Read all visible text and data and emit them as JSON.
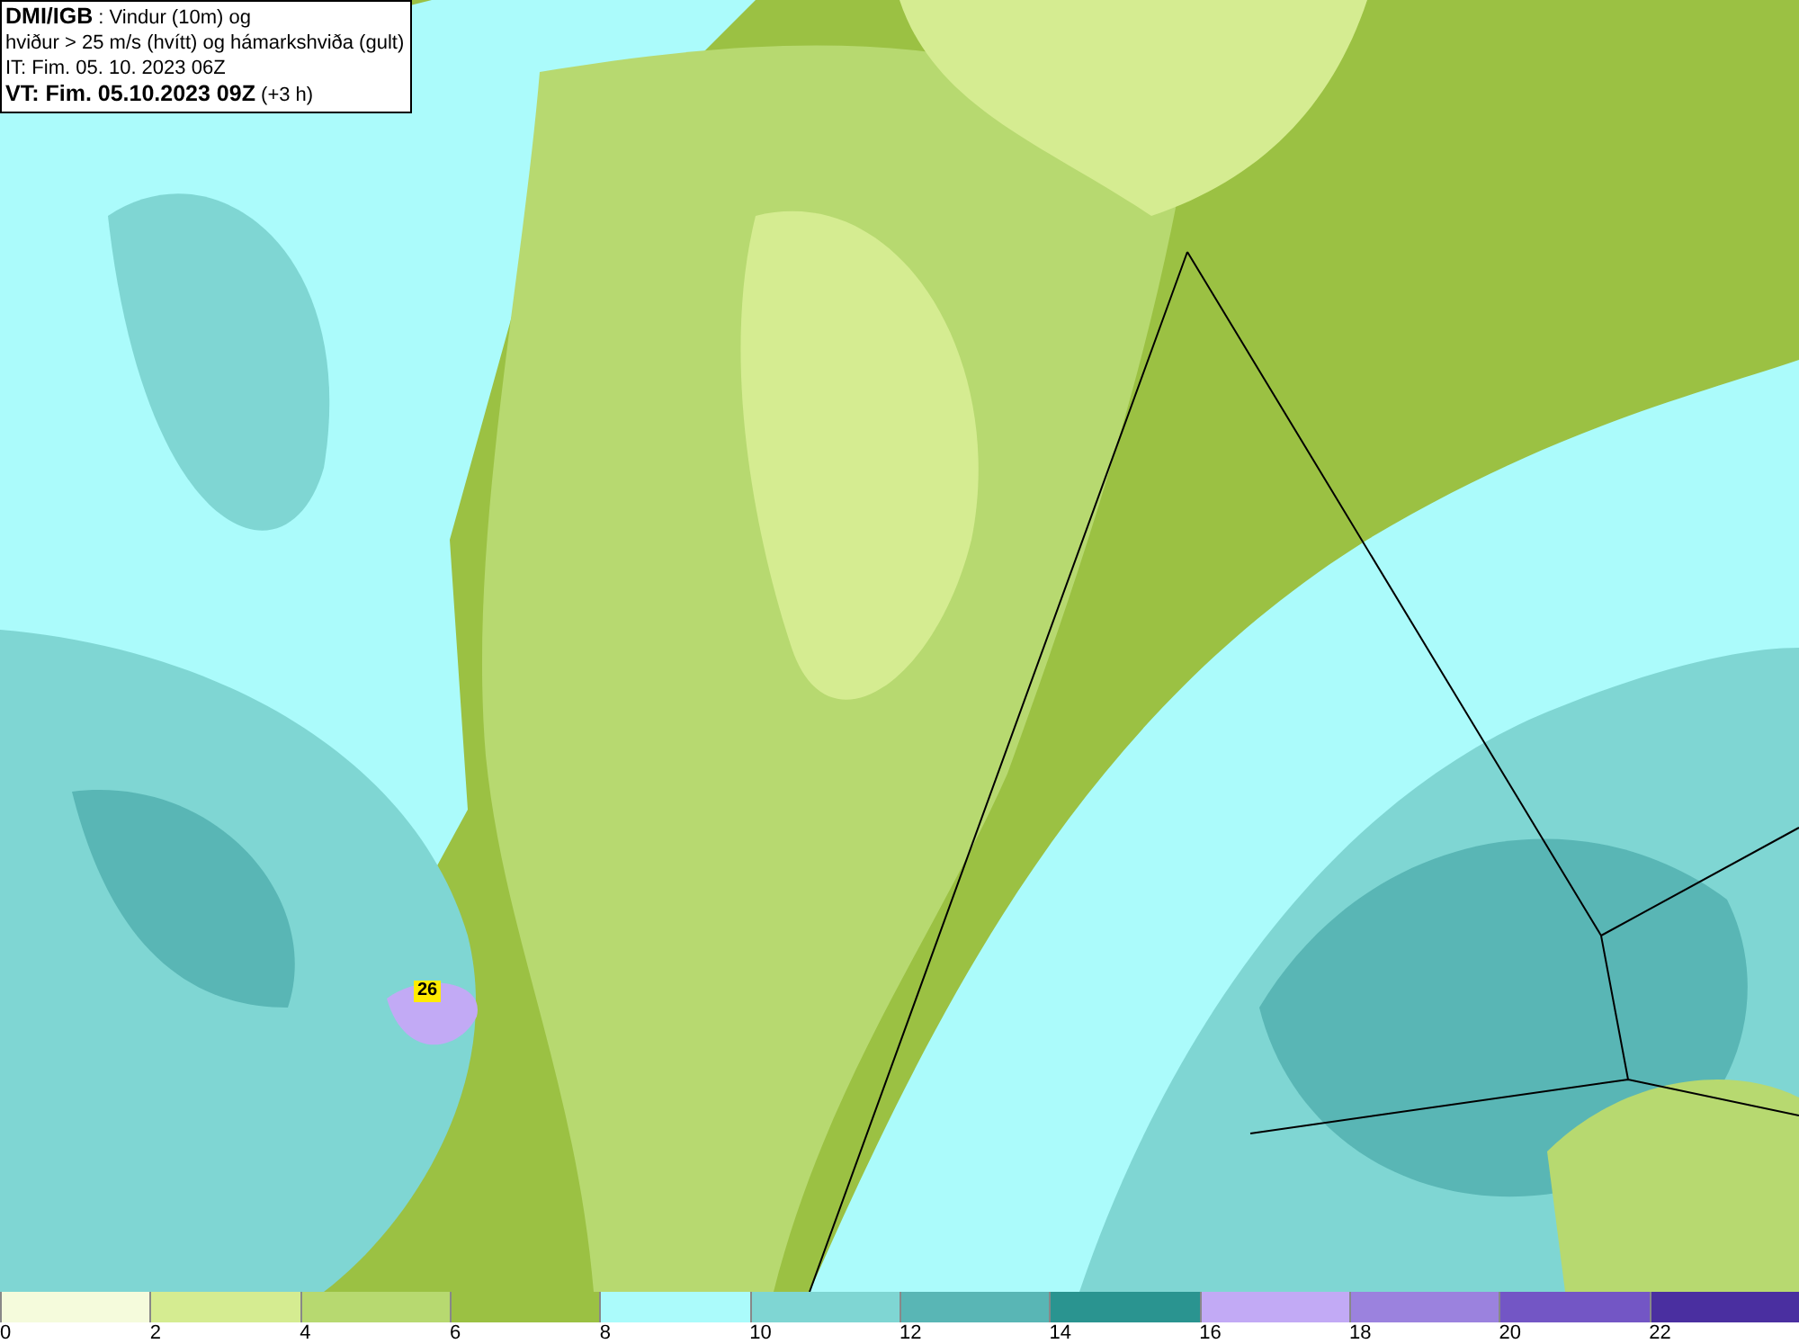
{
  "title_box": {
    "lines": [
      "**DMI/IGB** : Vindur (10m) og",
      "hviður > 25 m/s (hvítt) og hámarkshviða (gult)",
      "IT: Fim. 05. 10. 2023 06Z",
      "**VT: Fim. 05.10.2023 09Z** (+3 h)"
    ]
  },
  "gust_marker": {
    "label": "26"
  },
  "legend": [
    {
      "label": "0",
      "color": "#f5fbdc"
    },
    {
      "label": "2",
      "color": "#d5ec91"
    },
    {
      "label": "4",
      "color": "#b7d970"
    },
    {
      "label": "6",
      "color": "#9bc143"
    },
    {
      "label": "8",
      "color": "#abfbfb"
    },
    {
      "label": "10",
      "color": "#7fd6d3"
    },
    {
      "label": "12",
      "color": "#59b6b5"
    },
    {
      "label": "14",
      "color": "#2a9490"
    },
    {
      "label": "16",
      "color": "#c2aaf5"
    },
    {
      "label": "18",
      "color": "#9b82de"
    },
    {
      "label": "20",
      "color": "#7356c5"
    },
    {
      "label": "22",
      "color": "#4a2fa0"
    }
  ]
}
